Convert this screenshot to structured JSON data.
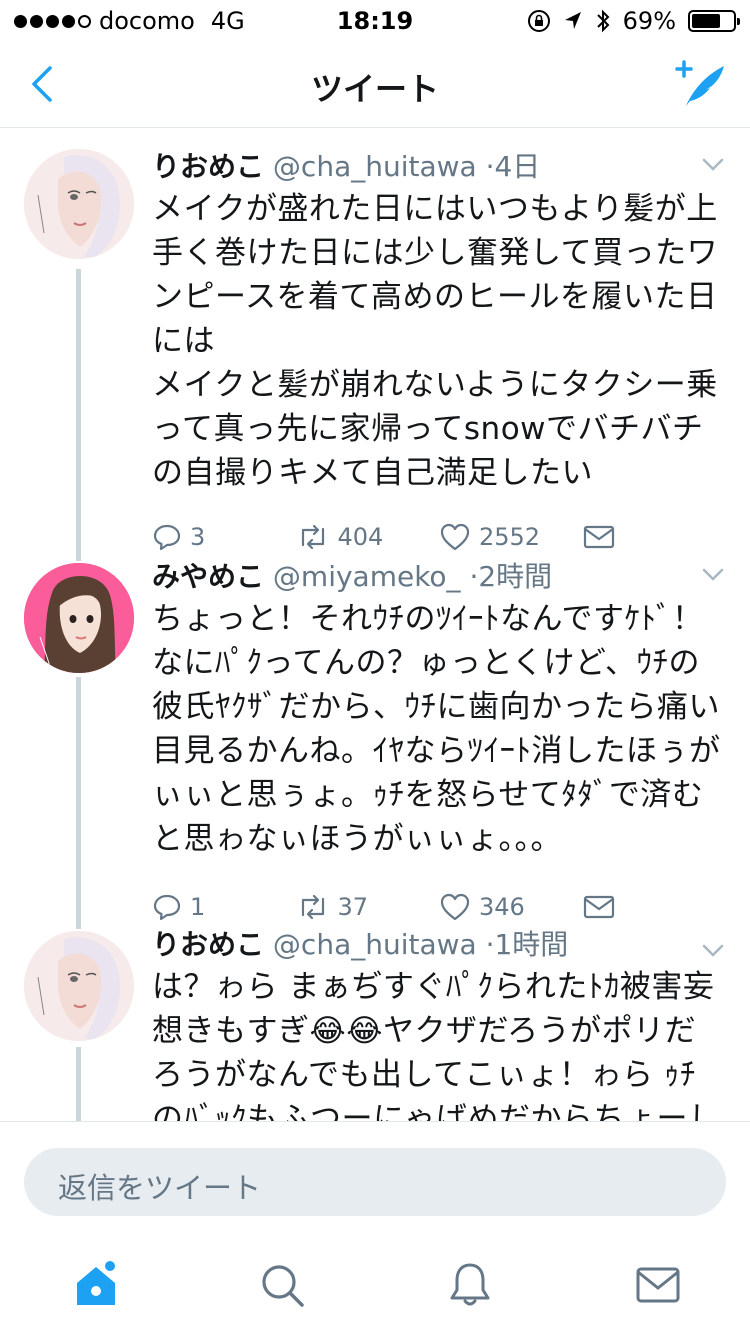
{
  "status_bar": {
    "carrier": "docomo",
    "network": "4G",
    "time": "18:19",
    "battery": "69%",
    "battery_level": 0.69,
    "signal_bars": 4
  },
  "nav": {
    "title": "ツイート"
  },
  "tweets": [
    {
      "name": "りおめこ",
      "handle": "@cha_huitawa",
      "time": "·4日",
      "text": "メイクが盛れた日にはいつもより髪が上\n手く巻けた日には少し奮発して買ったワ\nンピースを着て高めのヒールを履いた日\nには\nメイクと髪が崩れないようにタクシー乗\nって真っ先に家帰ってsnowでバチバチ\nの自撮りキメて自己満足したい",
      "replies": "3",
      "retweets": "404",
      "likes": "2552"
    },
    {
      "name": "みやめこ",
      "handle": "@miyameko_",
      "time": "·2時間",
      "text": "ちょっと！それｳﾁのﾂｲｰﾄなんですｹﾄﾞ！\nなにﾊﾟｸってんの？ゅっとくけど、ｳﾁの\n彼氏ﾔｸｻﾞだから、ｳﾁに歯向かったら痛い\n目見るかんね。ｲﾔならﾂｲｰﾄ消したほぅが\nぃぃと思ぅょ。ｩﾁを怒らせてﾀﾀﾞで済む\nと思ゎなぃほうがぃぃょ。。。",
      "replies": "1",
      "retweets": "37",
      "likes": "346"
    },
    {
      "name": "りおめこ",
      "handle": "@cha_huitawa",
      "time": "·1時間",
      "text": "は？ゎら まぁぢすぐﾊﾟｸられたﾄｶ被害妄\n想きもすぎ😂😂ヤクザだろうがポリだ\nろうがなんでも出してこぃょ！ゎら ｩﾁ\nのﾊﾞｯｸもふつーにゃばめだからちょーし"
    }
  ],
  "reply_bar": {
    "placeholder": "返信をツイート"
  },
  "colors": {
    "accent": "#1da1f2",
    "text_primary": "#14171a",
    "text_secondary": "#657786",
    "thread_line": "#ccd6dd"
  }
}
